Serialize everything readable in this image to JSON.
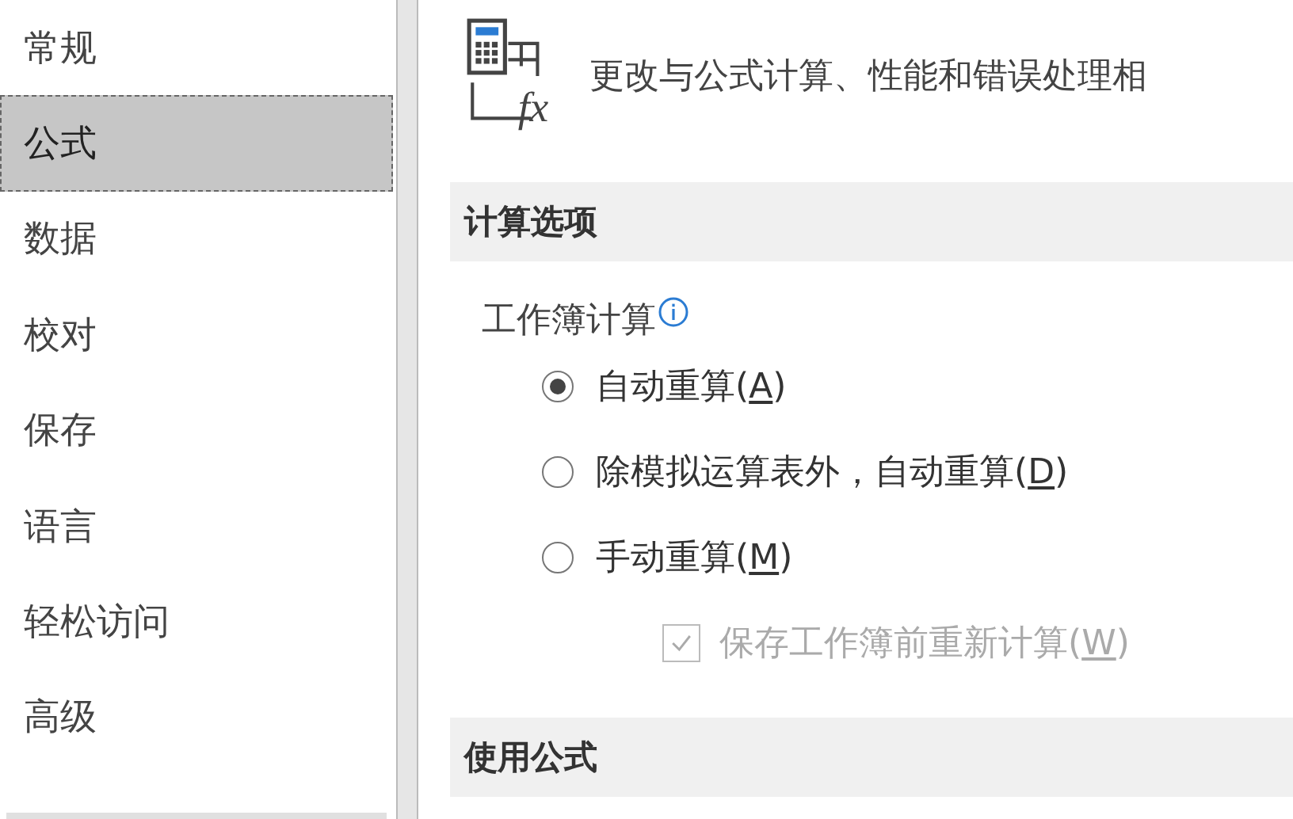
{
  "sidebar": {
    "items": [
      {
        "label": "常规",
        "selected": false
      },
      {
        "label": "公式",
        "selected": true
      },
      {
        "label": "数据",
        "selected": false
      },
      {
        "label": "校对",
        "selected": false
      },
      {
        "label": "保存",
        "selected": false
      },
      {
        "label": "语言",
        "selected": false
      },
      {
        "label": "轻松访问",
        "selected": false
      },
      {
        "label": "高级",
        "selected": false
      }
    ]
  },
  "header": {
    "icon_text": "fx",
    "description": "更改与公式计算、性能和错误处理相"
  },
  "sections": [
    {
      "title": "计算选项",
      "group_label": "工作簿计算",
      "options": [
        {
          "kind": "radio",
          "parts": [
            "自动重算(",
            "A",
            ")"
          ],
          "selected": true,
          "disabled": false
        },
        {
          "kind": "radio",
          "parts": [
            "除模拟运算表外，自动重算(",
            "D",
            ")"
          ],
          "selected": false,
          "disabled": false
        },
        {
          "kind": "radio",
          "parts": [
            "手动重算(",
            "M",
            ")"
          ],
          "selected": false,
          "disabled": false
        },
        {
          "kind": "checkbox",
          "parts": [
            "保存工作簿前重新计算(",
            "W",
            ")"
          ],
          "checked": true,
          "disabled": true
        }
      ]
    },
    {
      "title": "使用公式"
    }
  ]
}
